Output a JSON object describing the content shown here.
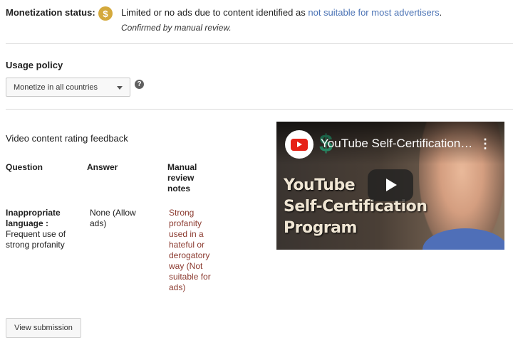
{
  "monetization": {
    "label": "Monetization status:",
    "icon": "dollar-icon",
    "icon_glyph": "$",
    "text": "Limited or no ads due to content identified as",
    "link": "not suitable for most advertisers",
    "period": ".",
    "subtext": "Confirmed by manual review."
  },
  "usage_policy": {
    "title": "Usage policy",
    "selected": "Monetize in all countries",
    "help_glyph": "?"
  },
  "feedback": {
    "title": "Video content rating feedback",
    "headers": [
      "Question",
      "Answer",
      "Manual review notes"
    ],
    "rows": [
      {
        "question_label": "Inappropriate language :",
        "question_detail": "Frequent use of strong profanity",
        "answer": "None (Allow ads)",
        "notes": "Strong profanity used in a hateful or derogatory way (Not suitable for ads)"
      }
    ]
  },
  "view_button": "View submission",
  "video": {
    "title": "YouTube Self-Certification Program",
    "thumb_line1": "YouTube",
    "thumb_line2": "Self-Certification",
    "thumb_line3": "Program",
    "menu_glyph": "⋮",
    "deco_glyph": "$"
  },
  "colors": {
    "link": "#4b73b5",
    "notes": "#8b3a2f",
    "dollar_badge": "#d4a93c",
    "youtube_red": "#e62117"
  }
}
